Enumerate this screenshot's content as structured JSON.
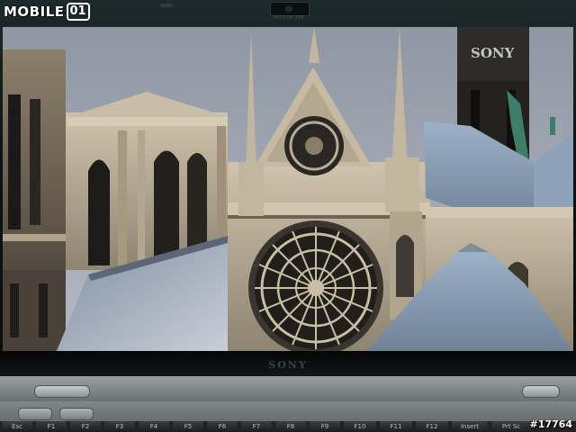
{
  "watermark": {
    "brand_word": "MOBILE",
    "brand_badge": "01",
    "photo_id": "#17764"
  },
  "laptop": {
    "brand": "SONY",
    "camera_label": "MOTION EYE",
    "keys": [
      "Esc",
      "F1",
      "F2",
      "F3",
      "F4",
      "F5",
      "F6",
      "F7",
      "F8",
      "F9",
      "F10",
      "F11",
      "F12",
      "Insert",
      "Prt Sc"
    ]
  },
  "screen": {
    "scene": "Notre-Dame cathedral rose window and spire",
    "sky_color": "#a9b0bb",
    "roof_color": "#8d9bab",
    "stone_color": "#b9ad97",
    "in_video_logo": "SONY"
  }
}
